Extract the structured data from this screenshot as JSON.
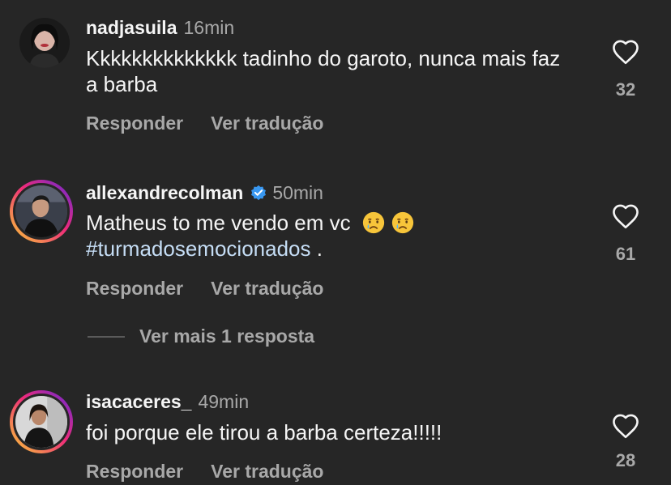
{
  "comments": [
    {
      "username": "nadjasuila",
      "timestamp": "16min",
      "text": "Kkkkkkkkkkkkkk tadinho do garoto, nunca mais faz a barba",
      "reply_label": "Responder",
      "translate_label": "Ver tradução",
      "likes": "32",
      "verified": false
    },
    {
      "username": "allexandrecolman",
      "timestamp": "50min",
      "text": "Matheus to me vendo em vc",
      "emojis": [
        "crying-face-emoji",
        "crying-face-emoji"
      ],
      "hashtag": "#turmadosemocionados",
      "trailing": " .",
      "reply_label": "Responder",
      "translate_label": "Ver tradução",
      "likes": "61",
      "verified": true,
      "more_replies": "Ver mais 1 resposta"
    },
    {
      "username": "isacaceres_",
      "timestamp": "49min",
      "text": "foi porque ele tirou a barba certeza!!!!!",
      "reply_label": "Responder",
      "translate_label": "Ver tradução",
      "likes": "28",
      "verified": false
    }
  ],
  "colors": {
    "background": "#262626",
    "primary_text": "#f5f5f5",
    "secondary_text": "#a8a8a8",
    "verified_badge": "#3897f0",
    "story_ring": "#ee2a7b"
  },
  "icons": {
    "like": "heart-outline-icon",
    "verified": "verified-badge-icon"
  }
}
